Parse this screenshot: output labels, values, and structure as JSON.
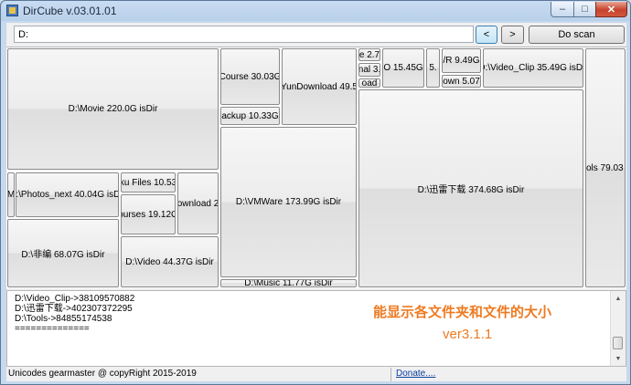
{
  "window": {
    "title": "DirCube v.03.01.01",
    "min_glyph": "–",
    "max_glyph": "□",
    "close_glyph": "✕"
  },
  "toolbar": {
    "path_value": "D:",
    "back_label": "<",
    "forward_label": ">",
    "scan_label": "Do scan"
  },
  "treemap": {
    "tiles": [
      {
        "label": "D:\\Movie 220.0G isDir"
      },
      {
        "label": "M"
      },
      {
        "label": "D:\\Photos_next 40.04G isDir"
      },
      {
        "label": "ku Files 10.53"
      },
      {
        "label": "ourses 19.12G"
      },
      {
        "label": "ownload 2"
      },
      {
        "label": "D:\\非编 68.07G isDir"
      },
      {
        "label": "D:\\Video 44.37G isDir"
      },
      {
        "label": "Course 30.03G"
      },
      {
        "label": "ackup 10.33G"
      },
      {
        "label": "YunDownload 49.5"
      },
      {
        "label": "D:\\VMWare 173.99G isDir"
      },
      {
        "label": "D:\\Music 11.77G isDir"
      },
      {
        "label": "e 2.7"
      },
      {
        "label": "nal 3."
      },
      {
        "label": "oad"
      },
      {
        "label": "O 15.45G"
      },
      {
        "label": "5."
      },
      {
        "label": "/R 9.49G"
      },
      {
        "label": "own 5.07"
      },
      {
        "label": "D:\\Video_Clip 35.49G isDir"
      },
      {
        "label": "D:\\迅雷下载 374.68G isDir"
      },
      {
        "label": "ols 79.03"
      }
    ]
  },
  "log": {
    "lines": [
      "D:\\Video_Clip->38109570882",
      "D:\\迅雷下载->402307372295",
      "D:\\Tools->84855174538",
      "",
      "=============="
    ],
    "hint": "能显示各文件夹和文件的大小",
    "version": "ver3.1.1"
  },
  "status": {
    "copyright": "Unicodes gearmaster @ copyRight 2015-2019",
    "donate": "Donate...."
  },
  "colors": {
    "accent_orange": "#ee7a22",
    "link_blue": "#0b3ea0"
  }
}
